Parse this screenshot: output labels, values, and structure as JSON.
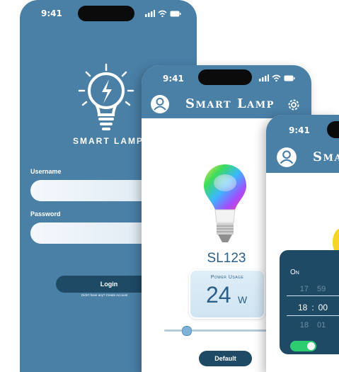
{
  "login_screen": {
    "time": "9:41",
    "brand": "SMART LAMP",
    "username_label": "Username",
    "password_label": "Password",
    "login_button": "Login",
    "footer": "Didn't have any? Create Account"
  },
  "lamp_screen": {
    "time": "9:41",
    "title": "Smart Lamp",
    "device_name": "SL123",
    "power_label": "Power Usage",
    "power_value": "24",
    "power_unit": "W",
    "brightness_level": 0.15,
    "default_button": "Default"
  },
  "timer_screen": {
    "time": "9:41",
    "title": "Sma",
    "timer_state": "On",
    "rows": [
      {
        "h": "17",
        "m": "59"
      },
      {
        "h": "18",
        "m": "00"
      },
      {
        "h": "18",
        "m": "01"
      }
    ],
    "colon": ":",
    "toggle_on": true
  },
  "colors": {
    "primary": "#4a7fa6",
    "dark": "#1f4a66",
    "button": "#1f4a66",
    "accent_text": "#2b5f87",
    "toggle": "#2ecc71"
  }
}
